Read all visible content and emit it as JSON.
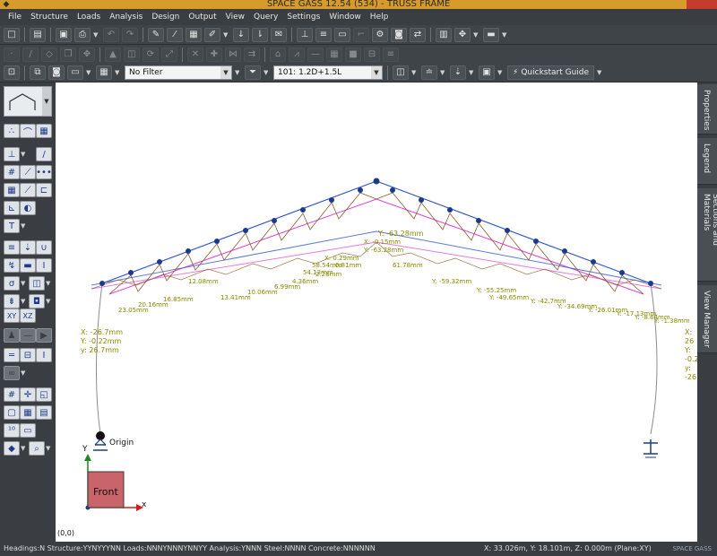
{
  "window": {
    "title": "SPACE GASS 12.54 (534) - TRUSS FRAME"
  },
  "menu": [
    "File",
    "Structure",
    "Loads",
    "Analysis",
    "Design",
    "Output",
    "View",
    "Query",
    "Settings",
    "Window",
    "Help"
  ],
  "toolbar3": {
    "filter_value": "No Filter",
    "loadcase_value": "101: 1.2D+1.5L",
    "quickstart_label": "Quickstart Guide"
  },
  "right_tabs": [
    "Properties",
    "Legend",
    "Sections and Materials",
    "View Manager"
  ],
  "canvas": {
    "origin_text": "Origin",
    "axis_y": "Y",
    "axis_x": "x",
    "view_label": "Front",
    "coords_corner": "(0,0)",
    "left_support_disp": [
      "X: -26.7mm",
      "Y: -0.22mm",
      "y: 26.7mm"
    ],
    "right_support_disp": [
      "X: 26",
      "Y: -0.2",
      "y: -26"
    ],
    "apex_label": "Y: -63.28mm",
    "defl_labels": [
      "X: -0.15mm",
      "Y: -63.28mm",
      "X: 0.29mm",
      "Y: -59.32mm",
      "Y: -55.25mm",
      "Y: -49.65mm",
      "Y: -42.7mm",
      "Y: -34.69mm",
      "Y: -26.01mm",
      "Y: -17.13mm",
      "Y: -8.64mm",
      "Y: -1.38mm",
      "12.08mm",
      "16.85mm",
      "20.16mm",
      "23.05mm",
      "13.41mm",
      "10.06mm",
      "6.99mm",
      "4.36mm",
      "2.28mm",
      "0.81mm",
      "58.54mm",
      "54.13mm",
      "61.78mm"
    ]
  },
  "status": {
    "left": "Headings:N Structure:YYNYYYNN Loads:NNNYNNNYNNYY Analysis:YNNN Steel:NNNN Concrete:NNNNNN",
    "coords": "X: 33.026m, Y: 18.101m, Z: 0.000m (Plane:XY)",
    "brand": "SPACE GASS"
  },
  "colors": {
    "truss_top": "#3559c8",
    "deflected": "#e040d0",
    "members": "#8b5a2b",
    "labels": "#8a8a00",
    "support": "#1a3a8a"
  }
}
